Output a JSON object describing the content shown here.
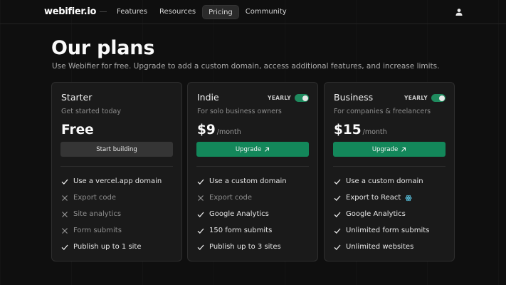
{
  "nav": {
    "logo": "webifier.io",
    "links": [
      {
        "label": "Features",
        "active": false
      },
      {
        "label": "Resources",
        "active": false
      },
      {
        "label": "Pricing",
        "active": true
      },
      {
        "label": "Community",
        "active": false
      }
    ],
    "user_icon": "user-icon"
  },
  "hero": {
    "title": "Our plans",
    "subtitle": "Use Webifier for free. Upgrade to add a custom domain, access additional features, and increase limits."
  },
  "colors": {
    "accent": "#13875a",
    "toggle": "#1f8a5e",
    "background": "#0f0f0f",
    "card": "#1a1a1a"
  },
  "plans": [
    {
      "name": "Starter",
      "description": "Get started today",
      "price": "Free",
      "price_unit": "",
      "yearly_label": "",
      "button_label": "Start building",
      "features": [
        {
          "label": "Use a vercel.app domain",
          "included": true
        },
        {
          "label": "Export code",
          "included": false
        },
        {
          "label": "Site analytics",
          "included": false
        },
        {
          "label": "Form submits",
          "included": false
        },
        {
          "label": "Publish up to 1 site",
          "included": true
        }
      ]
    },
    {
      "name": "Indie",
      "description": "For solo business owners",
      "price": "$9",
      "price_unit": "/month",
      "yearly_label": "YEARLY",
      "yearly_on": true,
      "button_label": "Upgrade",
      "features": [
        {
          "label": "Use a custom domain",
          "included": true
        },
        {
          "label": "Export code",
          "included": false
        },
        {
          "label": "Google Analytics",
          "included": true
        },
        {
          "label": "150 form submits",
          "included": true
        },
        {
          "label": "Publish up to 3 sites",
          "included": true
        }
      ]
    },
    {
      "name": "Business",
      "description": "For companies & freelancers",
      "price": "$15",
      "price_unit": "/month",
      "yearly_label": "YEARLY",
      "yearly_on": true,
      "button_label": "Upgrade",
      "features": [
        {
          "label": "Use a custom domain",
          "included": true
        },
        {
          "label": "Export to React",
          "included": true
        },
        {
          "label": "Google Analytics",
          "included": true
        },
        {
          "label": "Unlimited form submits",
          "included": true
        },
        {
          "label": "Unlimited websites",
          "included": true
        }
      ]
    }
  ]
}
